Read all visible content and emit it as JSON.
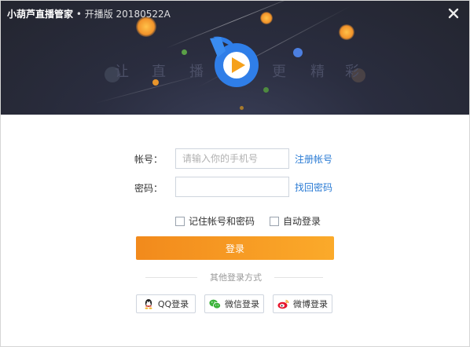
{
  "header": {
    "app_name": "小葫芦直播管家",
    "subtitle": " • 开播版 20180522A",
    "slogan": [
      "让",
      "直",
      "播",
      "更",
      "精",
      "彩"
    ]
  },
  "form": {
    "account_label": "帐号：",
    "account_placeholder": "请输入你的手机号",
    "account_value": "",
    "register_link": "注册帐号",
    "password_label": "密码：",
    "password_value": "",
    "recover_link": "找回密码",
    "remember_label": "记住帐号和密码",
    "remember_checked": false,
    "auto_login_label": "自动登录",
    "auto_login_checked": false,
    "login_button": "登录"
  },
  "other_login": {
    "label": "其他登录方式",
    "qq": "QQ登录",
    "wechat": "微信登录",
    "weibo": "微博登录"
  },
  "colors": {
    "header_bg": "#25272f",
    "accent_orange": "#f5981f",
    "link_blue": "#2a7bd4",
    "logo_blue": "#2f7ee8"
  }
}
